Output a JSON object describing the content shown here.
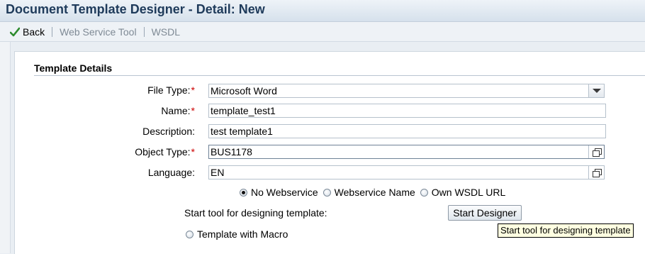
{
  "window": {
    "title": "Document Template Designer - Detail: New"
  },
  "toolbar": {
    "back_label": "Back",
    "web_service_tool_label": "Web Service Tool",
    "wsdl_label": "WSDL"
  },
  "section": {
    "title": "Template Details"
  },
  "form": {
    "file_type": {
      "label": "File Type:",
      "required": "*",
      "value": "Microsoft Word"
    },
    "name": {
      "label": "Name:",
      "required": "*",
      "value": "template_test1"
    },
    "description": {
      "label": "Description:",
      "value": "test template1"
    },
    "object_type": {
      "label": "Object Type:",
      "required": "*",
      "value": "BUS1178"
    },
    "language": {
      "label": "Language:",
      "value": "EN"
    }
  },
  "webservice_options": {
    "selected": "No Webservice",
    "options": [
      "No Webservice",
      "Webservice Name",
      "Own WSDL URL"
    ]
  },
  "designer": {
    "label": "Start tool for designing template:",
    "button_label": "Start Designer",
    "tooltip": "Start tool for designing template"
  },
  "macro_option": {
    "label": "Template with Macro",
    "selected": false
  },
  "colors": {
    "title_text": "#1f3b5b",
    "required_marker": "#cc0000",
    "tooltip_bg": "#ffffe1"
  }
}
